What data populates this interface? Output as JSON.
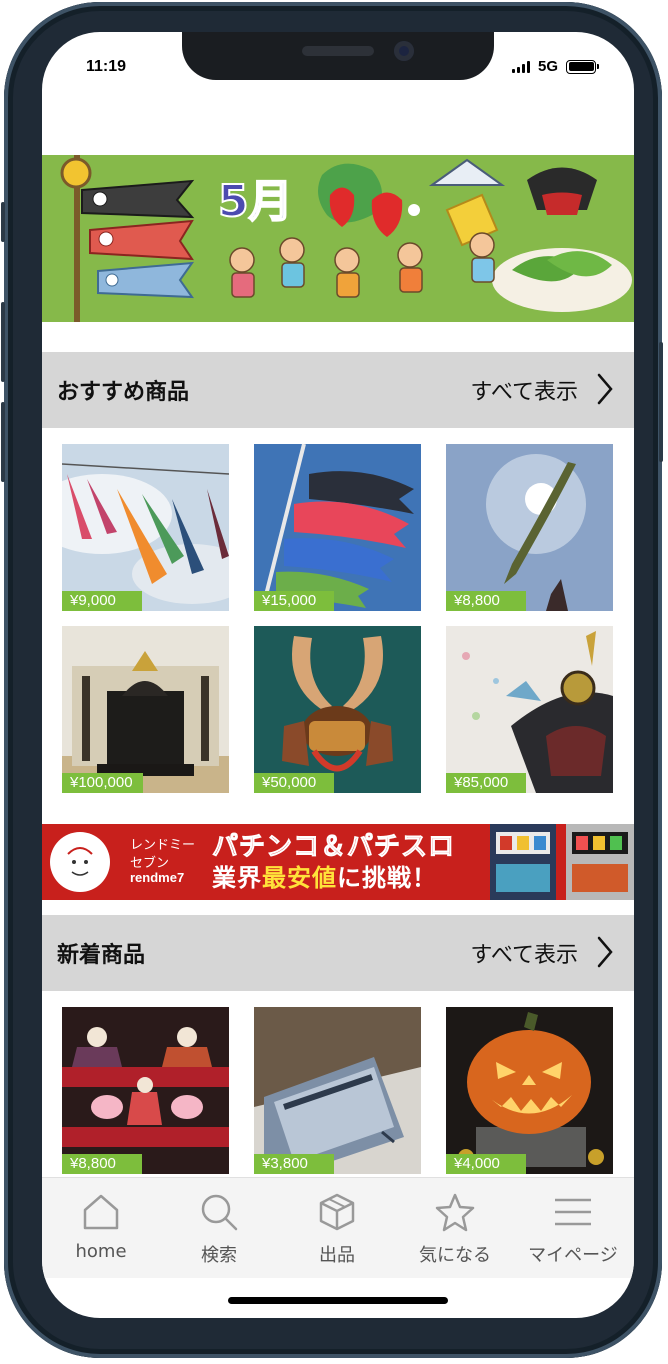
{
  "status_bar": {
    "time": "11:19",
    "network": "5G"
  },
  "banner": {
    "month": "5月"
  },
  "sections": {
    "recommended": {
      "title": "おすすめ商品",
      "see_all": "すべて表示"
    },
    "new": {
      "title": "新着商品",
      "see_all": "すべて表示"
    }
  },
  "recommended_products": [
    {
      "price": "¥9,000",
      "image": "carp-streamers-cloudy-sky"
    },
    {
      "price": "¥15,000",
      "image": "carp-streamers-blue-sky"
    },
    {
      "price": "¥8,800",
      "image": "green-carp-streamer-sun"
    },
    {
      "price": "¥100,000",
      "image": "samurai-armor-display"
    },
    {
      "price": "¥50,000",
      "image": "samurai-helmet-kabuto"
    },
    {
      "price": "¥85,000",
      "image": "armor-helmet-closeup"
    }
  ],
  "ad": {
    "brand_jp_line1": "レンドミー",
    "brand_jp_line2": "セブン",
    "brand_en": "rendme7",
    "headline": "パチンコ＆パチスロ",
    "subline_pre": "業界",
    "subline_highlight": "最安値",
    "subline_post": "に挑戦！"
  },
  "new_products": [
    {
      "price": "¥8,800",
      "image": "hina-dolls"
    },
    {
      "price": "¥3,800",
      "image": "folded-cloth"
    },
    {
      "price": "¥4,000",
      "image": "halloween-pumpkin"
    }
  ],
  "tabs": [
    {
      "label": "home",
      "icon": "home-icon"
    },
    {
      "label": "検索",
      "icon": "search-icon"
    },
    {
      "label": "出品",
      "icon": "box-icon"
    },
    {
      "label": "気になる",
      "icon": "star-icon"
    },
    {
      "label": "マイページ",
      "icon": "menu-icon"
    }
  ],
  "colors": {
    "price_badge": "#7dbe3c",
    "section_header": "#d6d6d6",
    "ad_background": "#c8201c",
    "banner_background": "#86b94a"
  }
}
